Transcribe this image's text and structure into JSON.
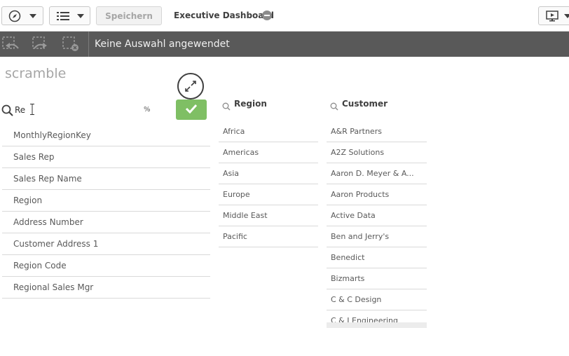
{
  "toolbar": {
    "save_label": "Speichern",
    "app_title": "Executive Dashboard"
  },
  "selection_bar": {
    "text": "Keine Auswahl angewendet"
  },
  "sheet": {
    "title": "scramble",
    "search": {
      "value": "Re",
      "suffix": "%"
    },
    "fields": [
      "MonthlyRegionKey",
      "Sales Rep",
      "Sales Rep Name",
      "Region",
      "Address Number",
      "Customer Address 1",
      "Region Code",
      "Regional Sales Mgr"
    ]
  },
  "region_listbox": {
    "title": "Region",
    "items": [
      "Africa",
      "Americas",
      "Asia",
      "Europe",
      "Middle East",
      "Pacific"
    ]
  },
  "customer_listbox": {
    "title": "Customer",
    "items": [
      "A&R Partners",
      "A2Z Solutions",
      "Aaron D. Meyer & A...",
      "Aaron Products",
      "Active Data",
      "Ben and Jerry's",
      "Benedict",
      "Bizmarts",
      "C & C Design",
      "C & J Engineering"
    ]
  },
  "colors": {
    "selection_bar": "#595959",
    "confirm_green": "#7fbf64"
  }
}
